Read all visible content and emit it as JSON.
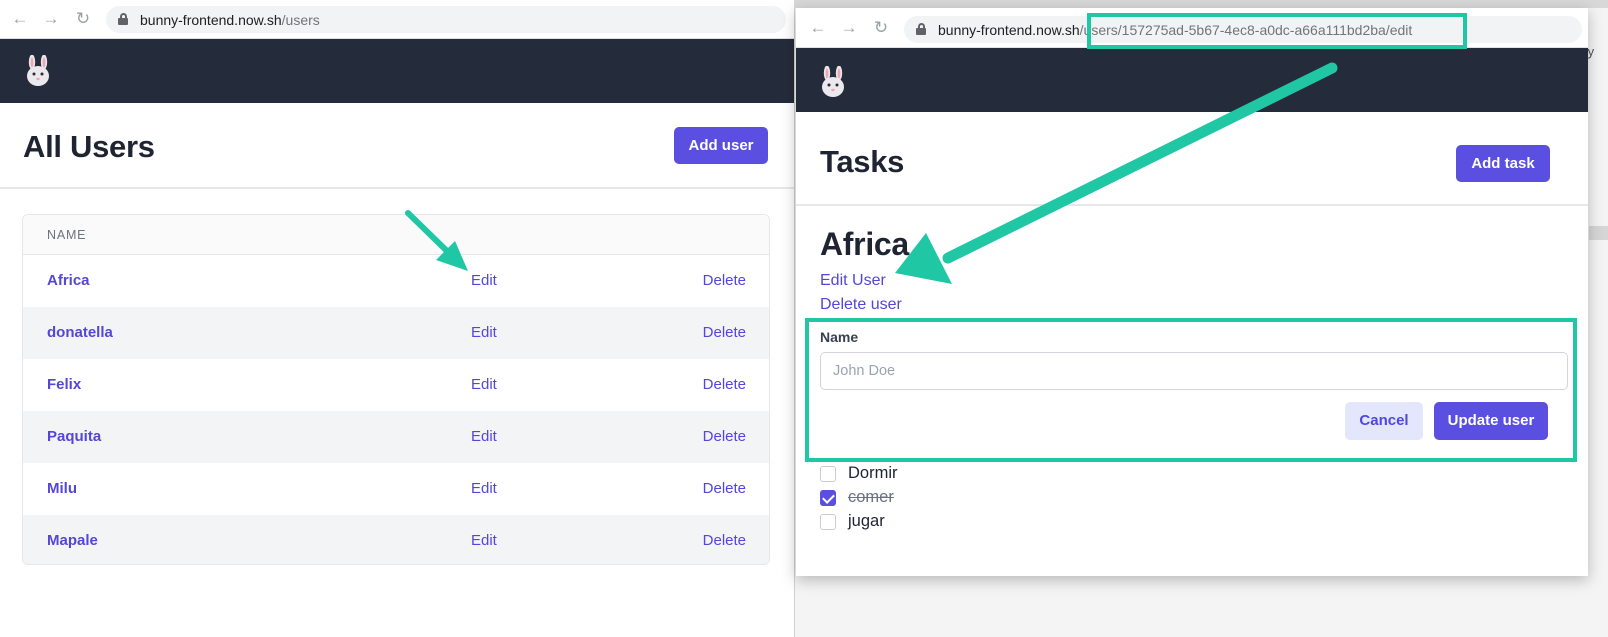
{
  "left_window": {
    "url_host": "bunny-frontend.now.sh",
    "url_path": "/users",
    "page_title": "All Users",
    "add_button_label": "Add user",
    "table": {
      "header": "NAME",
      "rows": [
        {
          "name": "Africa",
          "edit": "Edit",
          "delete": "Delete"
        },
        {
          "name": "donatella",
          "edit": "Edit",
          "delete": "Delete"
        },
        {
          "name": "Felix",
          "edit": "Edit",
          "delete": "Delete"
        },
        {
          "name": "Paquita",
          "edit": "Edit",
          "delete": "Delete"
        },
        {
          "name": "Milu",
          "edit": "Edit",
          "delete": "Delete"
        },
        {
          "name": "Mapale",
          "edit": "Edit",
          "delete": "Delete"
        }
      ]
    }
  },
  "right_window": {
    "url_host": "bunny-frontend.now.sh",
    "url_path": "/users/157275ad-5b67-4ec8-a0dc-a66a111bd2ba/edit",
    "page_title": "Tasks",
    "add_button_label": "Add task",
    "user_name": "Africa",
    "edit_user_link": "Edit User",
    "delete_user_link": "Delete user",
    "form": {
      "name_label": "Name",
      "name_placeholder": "John Doe",
      "name_value": "",
      "cancel_label": "Cancel",
      "update_label": "Update user"
    },
    "tasks": [
      {
        "label": "Dormir",
        "done": false
      },
      {
        "label": "comer",
        "done": true
      },
      {
        "label": "jugar",
        "done": false
      }
    ],
    "side_text": "ty"
  },
  "colors": {
    "accent": "#5a4fe0",
    "header_bg": "#242b3a",
    "annotation": "#1fc7a4"
  },
  "icons": [
    "back-arrow-icon",
    "forward-arrow-icon",
    "reload-icon",
    "lock-icon",
    "bunny-logo-icon",
    "annotation-arrow-icon"
  ]
}
